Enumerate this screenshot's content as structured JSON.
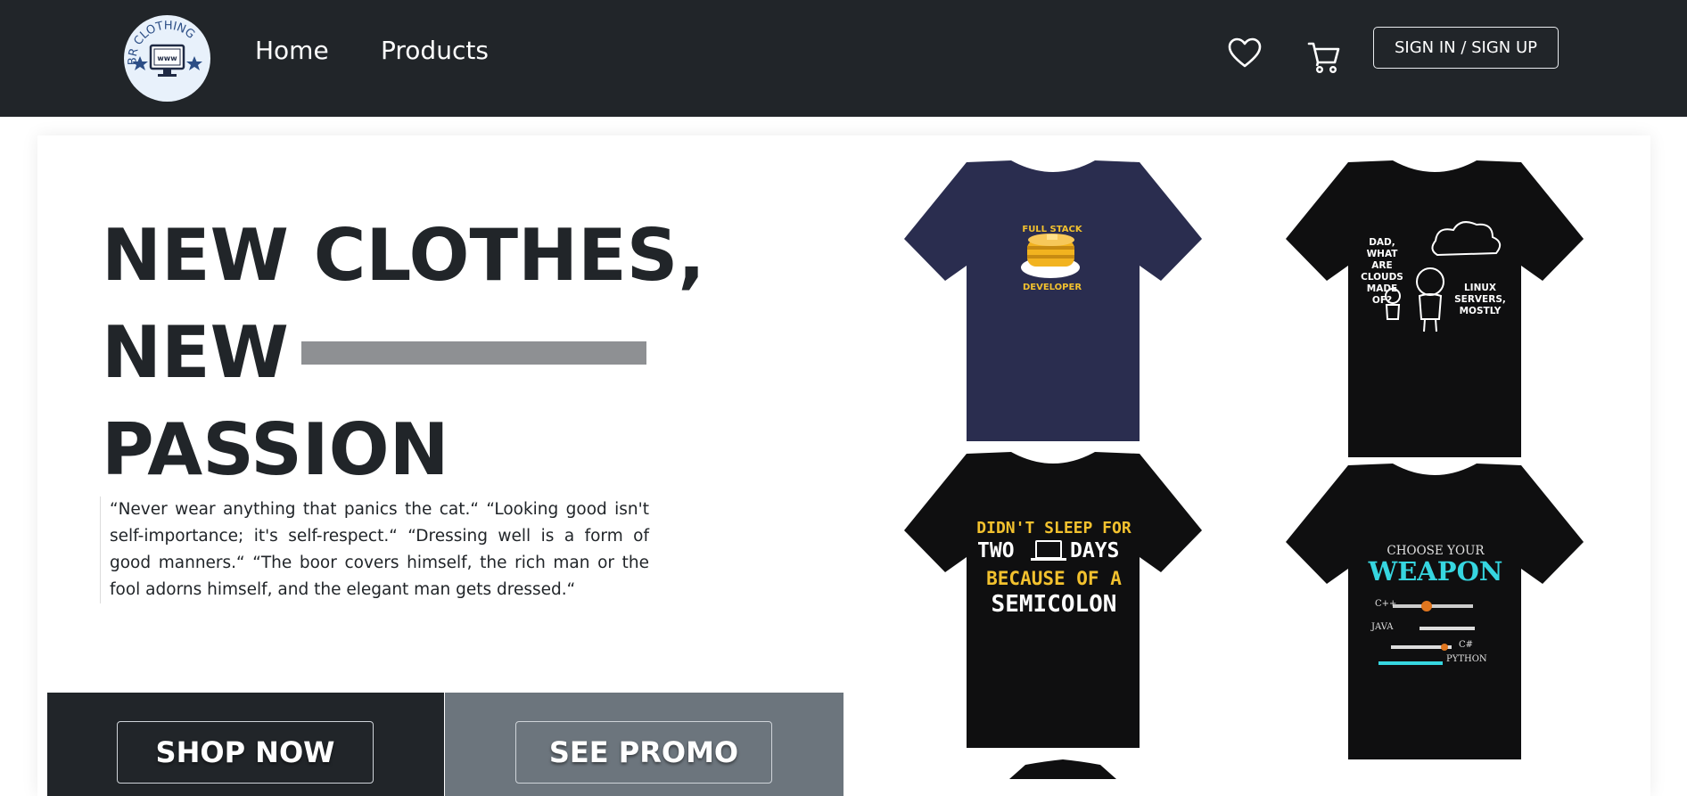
{
  "brand": {
    "logo_text": "BR CLOTHING",
    "logo_screen_text": "www"
  },
  "nav": {
    "home_label": "Home",
    "products_label": "Products",
    "wishlist_icon": "heart-icon",
    "cart_icon": "cart-icon",
    "signin_label": "SIGN IN / SIGN UP"
  },
  "hero": {
    "headline_line1": "NEW CLOTHES,",
    "headline_line2": "NEW",
    "headline_line3": "PASSION",
    "quote": "“Never wear anything that panics the cat.“ “Looking good isn't self-importance; it's self-respect.“ “Dressing well is a form of good manners.“ “The boor covers himself, the rich man or the fool adorns himself, and the elegant man gets dressed.“",
    "shop_now_label": "SHOP NOW",
    "see_promo_label": "SEE PROMO"
  },
  "products": [
    {
      "shirt_color": "#2a2d4f",
      "print_lines": [
        "FULL STACK",
        "DEVELOPER"
      ]
    },
    {
      "shirt_color": "#0f0f10",
      "print_lines": [
        "DAD,",
        "WHAT ARE",
        "CLOUDS",
        "MADE OF?",
        "LINUX",
        "SERVERS,",
        "MOSTLY"
      ]
    },
    {
      "shirt_color": "#0f0f10",
      "print_lines": [
        "DIDN'T SLEEP FOR",
        "TWO",
        "DAYS",
        "BECAUSE OF A",
        "SEMICOLON"
      ]
    },
    {
      "shirt_color": "#0f0f10",
      "print_lines": [
        "CHOOSE YOUR",
        "WEAPON",
        "C++",
        "JAVA",
        "C#",
        "PYTHON"
      ]
    }
  ],
  "colors": {
    "navbar": "#212529",
    "cta_dark": "#212529",
    "cta_gray": "#6c757d",
    "accent_yellow": "#f2c12e",
    "accent_cyan": "#36d6e0"
  }
}
